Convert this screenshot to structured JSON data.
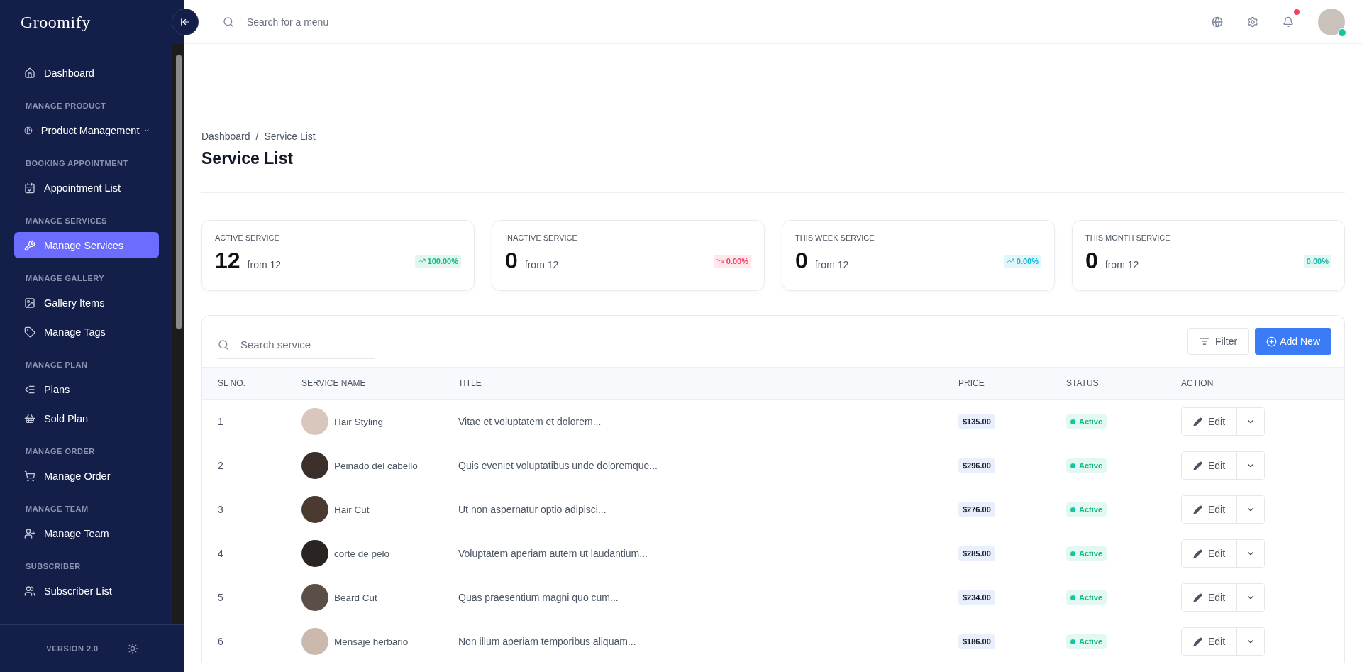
{
  "sidebar": {
    "logo": "Groomify",
    "sections": [
      {
        "items": [
          {
            "label": "Dashboard",
            "kind": "link",
            "selected": false
          }
        ]
      },
      {
        "heading": "MANAGE PRODUCT",
        "items": [
          {
            "label": "Product Management",
            "kind": "dropdown",
            "selected": false
          }
        ]
      },
      {
        "heading": "BOOKING APPOINTMENT",
        "items": [
          {
            "label": "Appointment List",
            "kind": "link",
            "selected": false
          }
        ]
      },
      {
        "heading": "MANAGE SERVICES",
        "items": [
          {
            "label": "Manage Services",
            "kind": "link",
            "selected": true
          }
        ]
      },
      {
        "heading": "MANAGE GALLERY",
        "items": [
          {
            "label": "Gallery Items",
            "kind": "link",
            "selected": false
          },
          {
            "label": "Manage Tags",
            "kind": "link",
            "selected": false
          }
        ]
      },
      {
        "heading": "MANAGE PLAN",
        "items": [
          {
            "label": "Plans",
            "kind": "link",
            "selected": false
          },
          {
            "label": "Sold Plan",
            "kind": "link",
            "selected": false
          }
        ]
      },
      {
        "heading": "MANAGE ORDER",
        "items": [
          {
            "label": "Manage Order",
            "kind": "link",
            "selected": false
          }
        ]
      },
      {
        "heading": "MANAGE TEAM",
        "items": [
          {
            "label": "Manage Team",
            "kind": "link",
            "selected": false
          }
        ]
      },
      {
        "heading": "SUBSCRIBER",
        "items": [
          {
            "label": "Subscriber List",
            "kind": "link",
            "selected": false
          }
        ]
      }
    ],
    "version": "VERSION 2.0"
  },
  "topbar": {
    "search": {
      "placeholder": "Search for a menu"
    },
    "notifications": {
      "unread": true
    },
    "user": {
      "online": true
    }
  },
  "breadcrumb": {
    "items": [
      "Dashboard",
      "Service List"
    ],
    "separator": "/"
  },
  "page_title": "Service List",
  "stats": [
    {
      "label": "ACTIVE SERVICE",
      "value": "12",
      "sub": "from 12",
      "change": "100.00%",
      "kind": "up",
      "color": "#10b981"
    },
    {
      "label": "INACTIVE SERVICE",
      "value": "0",
      "sub": "from 12",
      "change": "0.00%",
      "kind": "down",
      "color": "#f43f5e"
    },
    {
      "label": "THIS WEEK SERVICE",
      "value": "0",
      "sub": "from 12",
      "change": "0.00%",
      "kind": "up",
      "color": "#06b6d4"
    },
    {
      "label": "THIS MONTH SERVICE",
      "value": "0",
      "sub": "from 12",
      "change": "0.00%",
      "kind": "none",
      "color": "#14b8a6"
    }
  ],
  "table": {
    "search": {
      "placeholder": "Search service"
    },
    "filter": "Filter",
    "add": "Add New",
    "columns": [
      "SL NO.",
      "SERVICE NAME",
      "TITLE",
      "PRICE",
      "STATUS",
      "ACTION"
    ],
    "rows": [
      {
        "sl": "1",
        "name": "Hair Styling",
        "title": "Vitae et voluptatem et dolorem...",
        "price": "$135.00",
        "status": "Active",
        "active": true,
        "action": "Edit"
      },
      {
        "sl": "2",
        "name": "Peinado del cabello",
        "title": "Quis eveniet voluptatibus unde doloremque...",
        "price": "$296.00",
        "status": "Active",
        "active": true,
        "action": "Edit"
      },
      {
        "sl": "3",
        "name": "Hair Cut",
        "title": "Ut non aspernatur optio adipisci...",
        "price": "$276.00",
        "status": "Active",
        "active": true,
        "action": "Edit"
      },
      {
        "sl": "4",
        "name": "corte de pelo",
        "title": "Voluptatem aperiam autem ut laudantium...",
        "price": "$285.00",
        "status": "Active",
        "active": true,
        "action": "Edit"
      },
      {
        "sl": "5",
        "name": "Beard Cut",
        "title": "Quas praesentium magni quo cum...",
        "price": "$234.00",
        "status": "Active",
        "active": true,
        "action": "Edit"
      },
      {
        "sl": "6",
        "name": "Mensaje herbario",
        "title": "Non illum aperiam temporibus aliquam...",
        "price": "$186.00",
        "status": "Active",
        "active": true,
        "action": "Edit"
      }
    ]
  }
}
